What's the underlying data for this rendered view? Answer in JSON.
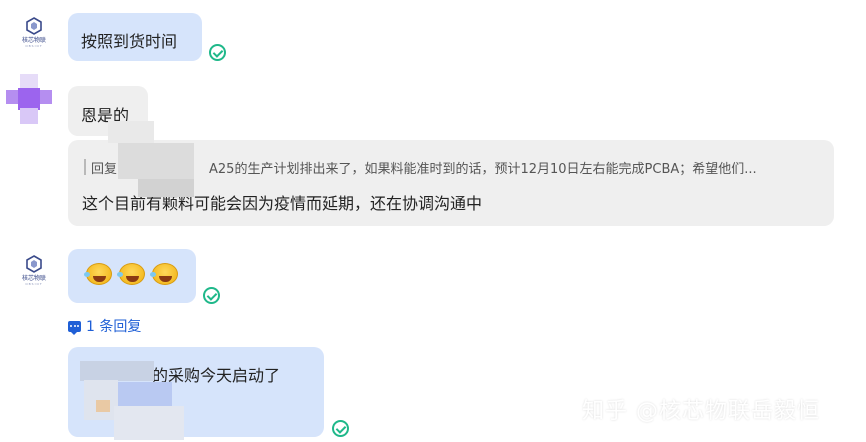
{
  "messages": [
    {
      "text": "按照到货时间"
    },
    {
      "text": "恩是的"
    },
    {
      "quote_prefix": "回复",
      "quote_text": "A25的生产计划排出来了，如果料能准时到的话，预计12月10日左右能完成PCBA；希望他们...",
      "text": "这个目前有颗料可能会因为疫情而延期，还在协调沟通中"
    },
    {
      "emoji_count": 3,
      "emoji": "rolling-on-floor-laughing"
    },
    {
      "text": "的采购今天启动了"
    }
  ],
  "logo": {
    "name": "核芯物联",
    "sub": "OBSIOT"
  },
  "reply_link": {
    "label": "1 条回复"
  },
  "watermark": "知乎 @核芯物联岳毅恒",
  "colors": {
    "bubble_blue": "#d6e4fb",
    "bubble_grey": "#efefef",
    "check_green": "#1fb88a",
    "link_blue": "#1f5fd6"
  }
}
